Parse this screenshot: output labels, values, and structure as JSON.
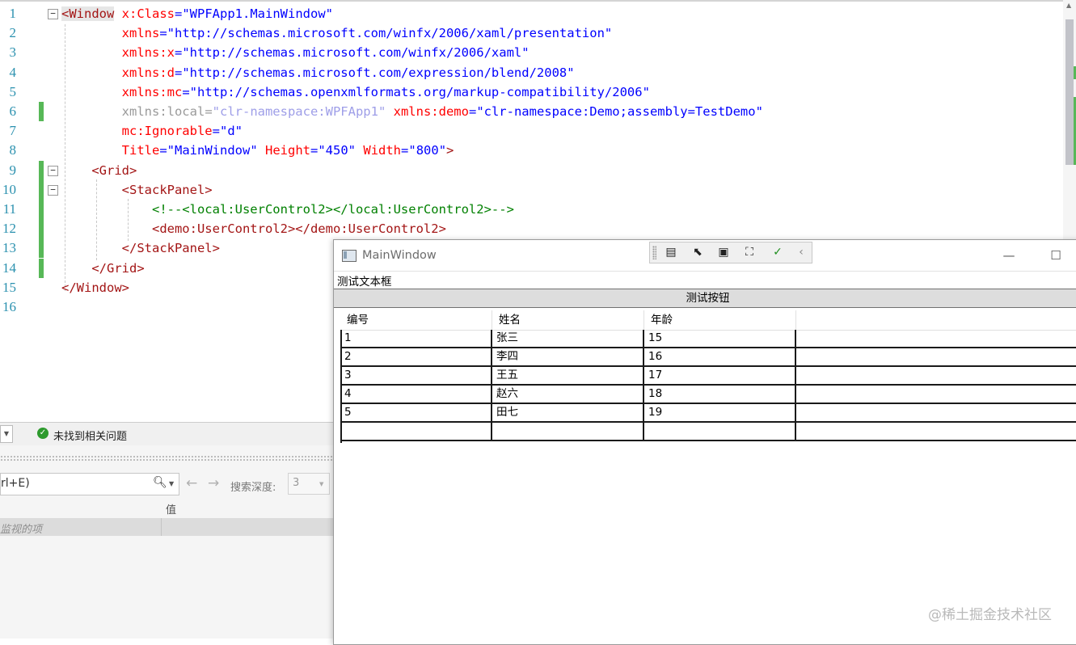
{
  "editor": {
    "lines": [
      {
        "no": "1",
        "parts": [
          {
            "c": "t-br",
            "t": "<Window"
          },
          {
            "c": "t-txt",
            "t": " "
          },
          {
            "c": "t-at",
            "t": "x:Class"
          },
          {
            "c": "t-dl",
            "t": "="
          },
          {
            "c": "t-vl",
            "t": "\"WPFApp1.MainWindow\""
          }
        ]
      },
      {
        "no": "2",
        "parts": [
          {
            "c": "t-txt",
            "t": "        "
          },
          {
            "c": "t-at",
            "t": "xmlns"
          },
          {
            "c": "t-dl",
            "t": "="
          },
          {
            "c": "t-vl",
            "t": "\"http://schemas.microsoft.com/winfx/2006/xaml/presentation\""
          }
        ]
      },
      {
        "no": "3",
        "parts": [
          {
            "c": "t-txt",
            "t": "        "
          },
          {
            "c": "t-at",
            "t": "xmlns:x"
          },
          {
            "c": "t-dl",
            "t": "="
          },
          {
            "c": "t-vl",
            "t": "\"http://schemas.microsoft.com/winfx/2006/xaml\""
          }
        ]
      },
      {
        "no": "4",
        "parts": [
          {
            "c": "t-txt",
            "t": "        "
          },
          {
            "c": "t-at",
            "t": "xmlns:d"
          },
          {
            "c": "t-dl",
            "t": "="
          },
          {
            "c": "t-vl",
            "t": "\"http://schemas.microsoft.com/expression/blend/2008\""
          }
        ]
      },
      {
        "no": "5",
        "parts": [
          {
            "c": "t-txt",
            "t": "        "
          },
          {
            "c": "t-at",
            "t": "xmlns:mc"
          },
          {
            "c": "t-dl",
            "t": "="
          },
          {
            "c": "t-vl",
            "t": "\"http://schemas.openxmlformats.org/markup-compatibility/2006\""
          }
        ]
      },
      {
        "no": "6",
        "parts": [
          {
            "c": "t-txt",
            "t": "        "
          },
          {
            "c": "t-dim",
            "t": "xmlns:local"
          },
          {
            "c": "t-dim",
            "t": "="
          },
          {
            "c": "t-dimv",
            "t": "\"clr-namespace:WPFApp1\""
          },
          {
            "c": "t-txt",
            "t": " "
          },
          {
            "c": "t-at",
            "t": "xmlns:demo"
          },
          {
            "c": "t-dl",
            "t": "="
          },
          {
            "c": "t-vl",
            "t": "\"clr-namespace:Demo;assembly=TestDemo\""
          }
        ]
      },
      {
        "no": "7",
        "parts": [
          {
            "c": "t-txt",
            "t": "        "
          },
          {
            "c": "t-at",
            "t": "mc:Ignorable"
          },
          {
            "c": "t-dl",
            "t": "="
          },
          {
            "c": "t-vl",
            "t": "\"d\""
          }
        ]
      },
      {
        "no": "8",
        "parts": [
          {
            "c": "t-txt",
            "t": "        "
          },
          {
            "c": "t-at",
            "t": "Title"
          },
          {
            "c": "t-dl",
            "t": "="
          },
          {
            "c": "t-vl",
            "t": "\"MainWindow\""
          },
          {
            "c": "t-txt",
            "t": " "
          },
          {
            "c": "t-at",
            "t": "Height"
          },
          {
            "c": "t-dl",
            "t": "="
          },
          {
            "c": "t-vl",
            "t": "\"450\""
          },
          {
            "c": "t-txt",
            "t": " "
          },
          {
            "c": "t-at",
            "t": "Width"
          },
          {
            "c": "t-dl",
            "t": "="
          },
          {
            "c": "t-vl",
            "t": "\"800\""
          },
          {
            "c": "t-br",
            "t": ">"
          }
        ]
      },
      {
        "no": "9",
        "parts": [
          {
            "c": "t-txt",
            "t": "    "
          },
          {
            "c": "t-br",
            "t": "<Grid>"
          }
        ]
      },
      {
        "no": "10",
        "parts": [
          {
            "c": "t-txt",
            "t": "        "
          },
          {
            "c": "t-br",
            "t": "<StackPanel>"
          }
        ]
      },
      {
        "no": "11",
        "parts": [
          {
            "c": "t-txt",
            "t": "            "
          },
          {
            "c": "t-cm",
            "t": "<!--<local:UserControl2></local:UserControl2>-->"
          }
        ]
      },
      {
        "no": "12",
        "parts": [
          {
            "c": "t-txt",
            "t": "            "
          },
          {
            "c": "t-br",
            "t": "<demo:UserControl2></demo:UserControl2>"
          }
        ]
      },
      {
        "no": "13",
        "parts": [
          {
            "c": "t-txt",
            "t": "        "
          },
          {
            "c": "t-br",
            "t": "</StackPanel>"
          }
        ]
      },
      {
        "no": "14",
        "parts": [
          {
            "c": "t-txt",
            "t": "    "
          },
          {
            "c": "t-br",
            "t": "</Grid>"
          }
        ]
      },
      {
        "no": "15",
        "parts": [
          {
            "c": "t-br",
            "t": "</Window>"
          }
        ]
      },
      {
        "no": "16",
        "parts": []
      }
    ]
  },
  "status": {
    "issues_text": "未找到相关问题"
  },
  "watch": {
    "search_placeholder": "rl+E)",
    "depth_label": "搜索深度:",
    "depth_value": "3",
    "column_value": "值",
    "add_hint": "监视的项"
  },
  "wpf_window": {
    "title": "MainWindow",
    "textbox_label": "测试文本框",
    "button_label": "测试按钮",
    "grid": {
      "columns": [
        "编号",
        "姓名",
        "年龄"
      ],
      "rows": [
        [
          "1",
          "张三",
          "15"
        ],
        [
          "2",
          "李四",
          "16"
        ],
        [
          "3",
          "王五",
          "17"
        ],
        [
          "4",
          "赵六",
          "18"
        ],
        [
          "5",
          "田七",
          "19"
        ]
      ]
    }
  },
  "watermark": "@稀土掘金技术社区"
}
